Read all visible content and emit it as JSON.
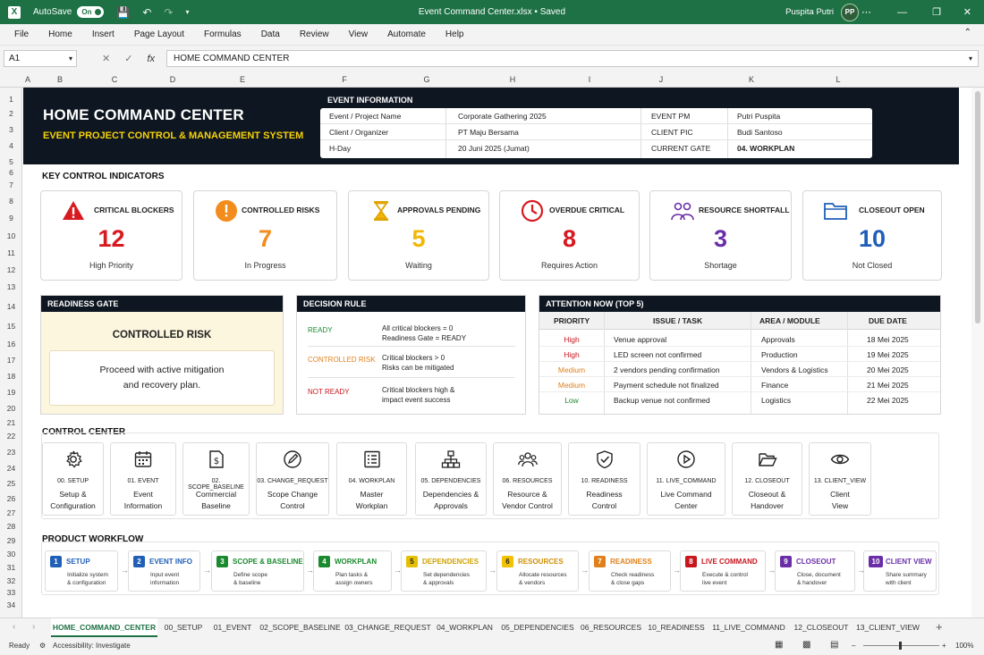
{
  "window": {
    "autosave_label": "AutoSave",
    "autosave_state": "On",
    "title": "Event Command Center.xlsx  •  Saved",
    "user": "Puspita Putri",
    "avatar": "PP"
  },
  "ribbon": {
    "tabs": [
      "File",
      "Home",
      "Insert",
      "Page Layout",
      "Formulas",
      "Data",
      "Review",
      "View",
      "Automate",
      "Help"
    ]
  },
  "formula_bar": {
    "name_box": "A1",
    "fx": "fx",
    "value": "HOME COMMAND CENTER"
  },
  "columns": [
    "A",
    "B",
    "C",
    "D",
    "E",
    "F",
    "G",
    "H",
    "I",
    "J",
    "K",
    "L"
  ],
  "rows": [
    "1",
    "2",
    "3",
    "4",
    "5",
    "6",
    "7",
    "8",
    "9",
    "10",
    "11",
    "12",
    "13",
    "14",
    "15",
    "16",
    "17",
    "18",
    "19",
    "20",
    "21",
    "22",
    "23",
    "24",
    "25",
    "26",
    "27",
    "28",
    "29",
    "30",
    "31",
    "32",
    "33",
    "34"
  ],
  "header": {
    "title": "HOME COMMAND CENTER",
    "subtitle": "EVENT PROJECT CONTROL & MANAGEMENT SYSTEM",
    "event_info_title": "EVENT INFORMATION",
    "info": [
      {
        "label": "Event / Project Name",
        "value": "Corporate Gathering 2025",
        "label2": "EVENT PM",
        "value2": "Putri Puspita"
      },
      {
        "label": "Client / Organizer",
        "value": "PT Maju Bersama",
        "label2": "CLIENT PIC",
        "value2": "Budi Santoso"
      },
      {
        "label": "H-Day",
        "value": "20 Juni 2025 (Jumat)",
        "label2": "CURRENT GATE",
        "value2": "04. WORKPLAN"
      }
    ]
  },
  "kpi_title": "KEY CONTROL INDICATORS",
  "kpis": [
    {
      "label": "CRITICAL BLOCKERS",
      "value": "12",
      "sub": "High Priority",
      "color": "#d71920",
      "icon": "warning-icon"
    },
    {
      "label": "CONTROLLED RISKS",
      "value": "7",
      "sub": "In Progress",
      "color": "#f28c1c",
      "icon": "alert-circle-icon"
    },
    {
      "label": "APPROVALS PENDING",
      "value": "5",
      "sub": "Waiting",
      "color": "#f2b705",
      "icon": "hourglass-icon"
    },
    {
      "label": "OVERDUE CRITICAL",
      "value": "8",
      "sub": "Requires Action",
      "color": "#d71920",
      "icon": "clock-icon"
    },
    {
      "label": "RESOURCE SHORTFALL",
      "value": "3",
      "sub": "Shortage",
      "color": "#6a2fa8",
      "icon": "people-icon"
    },
    {
      "label": "CLOSEOUT OPEN",
      "value": "10",
      "sub": "Not Closed",
      "color": "#1f5fb8",
      "icon": "folder-icon"
    }
  ],
  "readiness": {
    "title": "READINESS GATE",
    "status": "CONTROLLED RISK",
    "line1": "Proceed with active mitigation",
    "line2": "and recovery plan."
  },
  "decision": {
    "title": "DECISION RULE",
    "rules": [
      {
        "key": "READY",
        "color": "#1a8a2e",
        "line1": "All critical blockers = 0",
        "line2": "Readiness Gate = READY"
      },
      {
        "key": "CONTROLLED RISK",
        "color": "#e0801a",
        "line1": "Critical blockers > 0",
        "line2": "Risks can be mitigated"
      },
      {
        "key": "NOT READY",
        "color": "#c8161d",
        "line1": "Critical blockers high &",
        "line2": "impact event success"
      }
    ]
  },
  "attention": {
    "title": "ATTENTION NOW (TOP 5)",
    "headers": [
      "PRIORITY",
      "ISSUE / TASK",
      "AREA / MODULE",
      "DUE DATE"
    ],
    "rows": [
      {
        "priority": "High",
        "color": "#c8161d",
        "task": "Venue approval",
        "area": "Approvals",
        "due": "18 Mei 2025"
      },
      {
        "priority": "High",
        "color": "#c8161d",
        "task": "LED screen not confirmed",
        "area": "Production",
        "due": "19 Mei 2025"
      },
      {
        "priority": "Medium",
        "color": "#e0801a",
        "task": "2 vendors pending confirmation",
        "area": "Vendors & Logistics",
        "due": "20 Mei 2025"
      },
      {
        "priority": "Medium",
        "color": "#e0801a",
        "task": "Payment schedule not finalized",
        "area": "Finance",
        "due": "21 Mei 2025"
      },
      {
        "priority": "Low",
        "color": "#1a8a2e",
        "task": "Backup venue not confirmed",
        "area": "Logistics",
        "due": "22 Mei 2025"
      }
    ]
  },
  "control_center": {
    "title": "CONTROL CENTER",
    "items": [
      {
        "code": "00. SETUP",
        "l1": "Setup &",
        "l2": "Configuration",
        "icon": "gear-icon"
      },
      {
        "code": "01. EVENT",
        "l1": "Event",
        "l2": "Information",
        "icon": "calendar-icon"
      },
      {
        "code": "02. SCOPE_BASELINE",
        "l1": "Commercial",
        "l2": "Baseline",
        "icon": "money-document-icon"
      },
      {
        "code": "03. CHANGE_REQUEST",
        "l1": "Scope Change",
        "l2": "Control",
        "icon": "edit-icon"
      },
      {
        "code": "04. WORKPLAN",
        "l1": "Master",
        "l2": "Workplan",
        "icon": "checklist-icon"
      },
      {
        "code": "05. DEPENDENCIES",
        "l1": "Dependencies &",
        "l2": "Approvals",
        "icon": "hierarchy-icon"
      },
      {
        "code": "06. RESOURCES",
        "l1": "Resource &",
        "l2": "Vendor Control",
        "icon": "group-icon"
      },
      {
        "code": "10. READINESS",
        "l1": "Readiness",
        "l2": "Control",
        "icon": "shield-check-icon"
      },
      {
        "code": "11. LIVE_COMMAND",
        "l1": "Live Command",
        "l2": "Center",
        "icon": "play-icon"
      },
      {
        "code": "12. CLOSEOUT",
        "l1": "Closeout &",
        "l2": "Handover",
        "icon": "folder-open-icon"
      },
      {
        "code": "13. CLIENT_VIEW",
        "l1": "Client",
        "l2": "View",
        "icon": "eye-icon"
      }
    ]
  },
  "workflow": {
    "title": "PRODUCT WORKFLOW",
    "steps": [
      {
        "n": "1",
        "title": "SETUP",
        "color": "#1f5fb8",
        "d1": "Initialize system",
        "d2": "& configuration"
      },
      {
        "n": "2",
        "title": "EVENT INFO",
        "color": "#1f5fb8",
        "d1": "Input event",
        "d2": "information"
      },
      {
        "n": "3",
        "title": "SCOPE & BASELINE",
        "color": "#1a8a2e",
        "d1": "Define scope",
        "d2": "& baseline"
      },
      {
        "n": "4",
        "title": "WORKPLAN",
        "color": "#1a8a2e",
        "d1": "Plan tasks &",
        "d2": "assign owners"
      },
      {
        "n": "5",
        "title": "DEPENDENCIES",
        "color": "#e6c000",
        "d1": "Set dependencies",
        "d2": "& approvals"
      },
      {
        "n": "6",
        "title": "RESOURCES",
        "color": "#e6b000",
        "d1": "Allocate resources",
        "d2": "& vendors"
      },
      {
        "n": "7",
        "title": "READINESS",
        "color": "#e0801a",
        "d1": "Check readiness",
        "d2": "& close gaps"
      },
      {
        "n": "8",
        "title": "LIVE COMMAND",
        "color": "#c8161d",
        "d1": "Execute & control",
        "d2": "live event"
      },
      {
        "n": "9",
        "title": "CLOSEOUT",
        "color": "#6a2fa8",
        "d1": "Close, document",
        "d2": "& handover"
      },
      {
        "n": "10",
        "title": "CLIENT VIEW",
        "color": "#6a2fa8",
        "d1": "Share summary",
        "d2": "with client"
      }
    ]
  },
  "sheet_tabs": [
    "HOME_COMMAND_CENTER",
    "00_SETUP",
    "01_EVENT",
    "02_SCOPE_BASELINE",
    "03_CHANGE_REQUEST",
    "04_WORKPLAN",
    "05_DEPENDENCIES",
    "06_RESOURCES",
    "10_READINESS",
    "11_LIVE_COMMAND",
    "12_CLOSEOUT",
    "13_CLIENT_VIEW"
  ],
  "status": {
    "ready": "Ready",
    "accessibility": "Accessibility: Investigate",
    "zoom": "100%"
  }
}
